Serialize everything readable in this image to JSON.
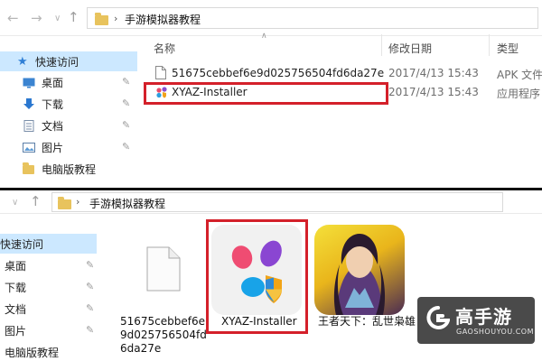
{
  "top": {
    "breadcrumb": "手游模拟器教程",
    "sidebar": [
      {
        "name": "quick-access",
        "label": "快速访问",
        "pinned": false
      },
      {
        "name": "desktop",
        "label": "桌面",
        "pinned": true
      },
      {
        "name": "downloads",
        "label": "下载",
        "pinned": true
      },
      {
        "name": "documents",
        "label": "文档",
        "pinned": true
      },
      {
        "name": "pictures",
        "label": "图片",
        "pinned": true
      },
      {
        "name": "folder-pc-tutorial",
        "label": "电脑版教程",
        "pinned": false
      }
    ],
    "columns": {
      "name": "名称",
      "date": "修改日期",
      "type": "类型"
    },
    "files": [
      {
        "name": "51675cebbef6e9d025756504fd6da27e",
        "date": "2017/4/13 15:43",
        "type": "APK 文件"
      },
      {
        "name": "XYAZ-Installer",
        "date": "2017/4/13 15:43",
        "type": "应用程序"
      }
    ]
  },
  "bottom": {
    "breadcrumb": "手游模拟器教程",
    "sidebar": [
      {
        "name": "quick-access",
        "label": "快速访问",
        "pinned": false
      },
      {
        "name": "desktop",
        "label": "桌面",
        "pinned": true
      },
      {
        "name": "downloads",
        "label": "下载",
        "pinned": true
      },
      {
        "name": "documents",
        "label": "文档",
        "pinned": true
      },
      {
        "name": "pictures",
        "label": "图片",
        "pinned": true
      },
      {
        "name": "folder-pc-tutorial",
        "label": "电脑版教程",
        "pinned": false
      }
    ],
    "tiles": [
      {
        "name": "apk-file-tile",
        "label_lines": [
          "51675cebbef6e",
          "9d025756504fd",
          "6da27e"
        ]
      },
      {
        "name": "xyaz-installer-tile",
        "label_lines": [
          "XYAZ-Installer"
        ]
      },
      {
        "name": "game-app-tile",
        "label_lines": [
          "王者天下：乱世枭雄"
        ]
      }
    ]
  },
  "watermark": {
    "brand": "高手游",
    "url": "GAOSHOUYOU.COM"
  },
  "colors": {
    "highlight": "#d4202a",
    "selection": "#cce8ff",
    "folder": "#e8c35d",
    "watermark_bg": "#4a4a4a"
  }
}
